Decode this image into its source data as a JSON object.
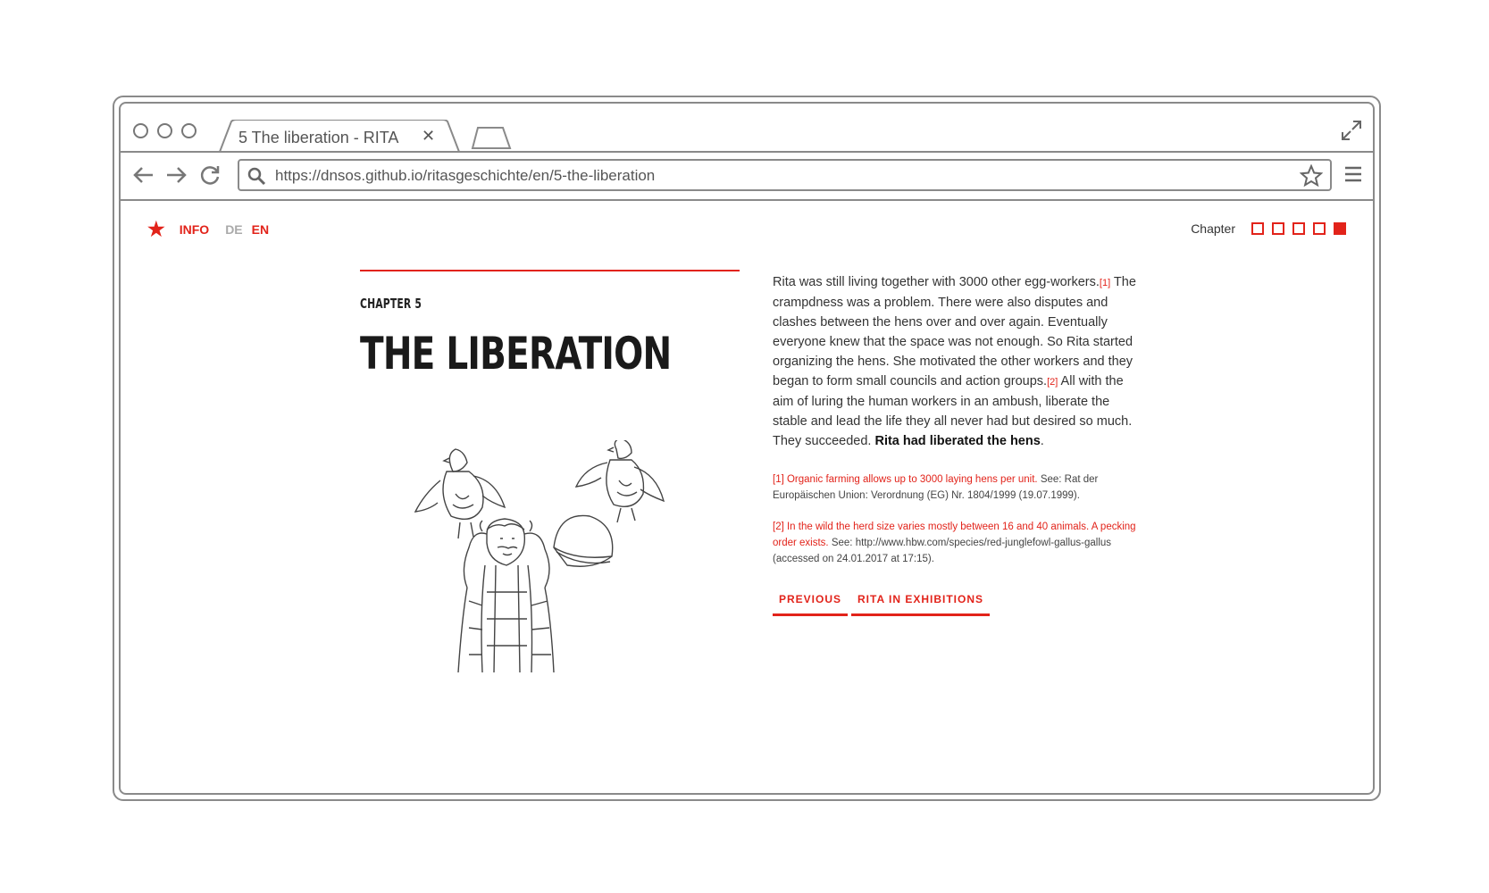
{
  "browser": {
    "tab_title": "5 The liberation - RITA",
    "url": "https://dnsos.github.io/ritasgeschichte/en/5-the-liberation"
  },
  "header": {
    "info": "INFO",
    "lang_de": "DE",
    "lang_en": "EN",
    "chapter_label": "Chapter",
    "chapter_count": 5,
    "active_chapter": 5
  },
  "chapter": {
    "kicker": "CHAPTER 5",
    "title": "THE LIBERATION"
  },
  "body": {
    "p1": "Rita was still living together with 3000 other egg-workers.",
    "ref1": "[1]",
    "p2": " The crampdness was a problem. There were also disputes and clashes between the hens over and over again. Eventually everyone knew that the space was not enough. So Rita started organizing the hens. She motivated the other workers and they began to form small councils and action groups.",
    "ref2": "[2]",
    "p3": " All with the aim of luring the human workers in an ambush, liberate the stable and lead the life they all never had but desired so much. They succeeded. ",
    "p3_bold": "Rita had liberated the hens",
    "p3_end": "."
  },
  "footnotes": [
    {
      "red": "[1] Organic farming allows up to 3000 laying hens per unit.",
      "rest": " See: Rat der Europäischen Union: Verordnung (EG) Nr. 1804/1999 (19.07.1999)."
    },
    {
      "red": "[2] In the wild the herd size varies mostly between 16 and 40 animals. A pecking order exists.",
      "rest": " See: http://www.hbw.com/species/red-junglefowl-gallus-gallus (accessed on 24.01.2017 at 17:15)."
    }
  ],
  "buttons": {
    "previous": "PREVIOUS",
    "next": "RITA IN EXHIBITIONS"
  },
  "colors": {
    "accent": "#e2231a"
  }
}
